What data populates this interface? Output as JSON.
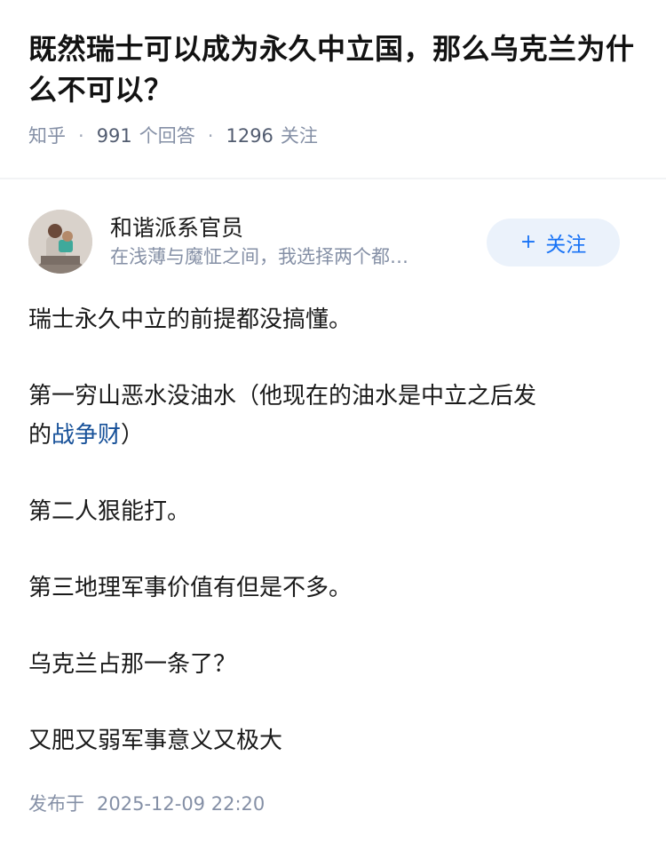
{
  "question": {
    "title": "既然瑞士可以成为永久中立国，那么乌克兰为什么不可以？",
    "source": "知乎",
    "answer_count": "991",
    "answer_label": "个回答",
    "follower_count": "1296",
    "follower_label": "关注"
  },
  "author": {
    "name": "和谐派系官员",
    "bio": "在浅薄与魔怔之间，我选择两个都…",
    "follow_label": "关注",
    "follow_icon": "plus-icon"
  },
  "answer": {
    "p1": "瑞士永久中立的前提都没搞懂。",
    "p2_line1": "第一穷山恶水没油水（他现在的油水是中立之后发",
    "p2_prefix": "的",
    "p2_link": "战争财",
    "p2_suffix": "）",
    "p3": "第二人狠能打。",
    "p4": "第三地理军事价值有但是不多。",
    "p5": "乌克兰占那一条了？",
    "p6": "又肥又弱军事意义又极大"
  },
  "footer": {
    "publish_label": "发布于",
    "publish_time": "2025-12-09 22:20"
  },
  "colors": {
    "link": "#175199",
    "follow_text": "#1772f6",
    "follow_bg": "#ebf2fb",
    "meta": "#8590a6"
  }
}
